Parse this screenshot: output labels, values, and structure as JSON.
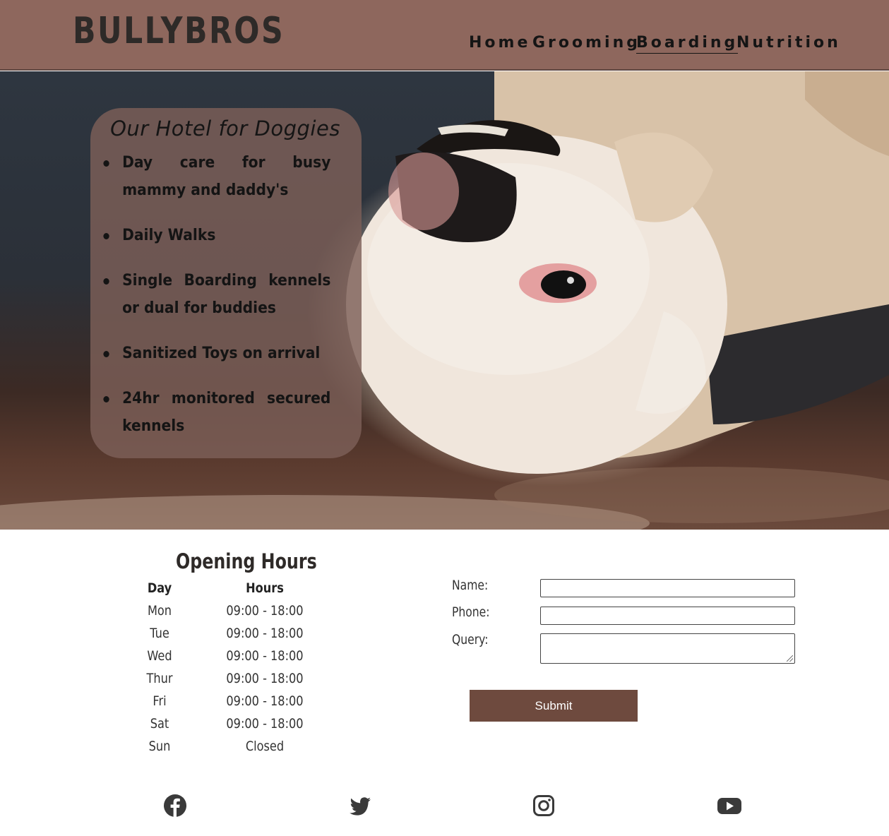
{
  "header": {
    "logo": "BULLYBROS",
    "nav": [
      {
        "label": "Home",
        "active": false
      },
      {
        "label": "Grooming",
        "active": false
      },
      {
        "label": "Boarding",
        "active": true
      },
      {
        "label": "Nutrition",
        "active": false
      }
    ]
  },
  "hero": {
    "title": "Our Hotel for Doggies",
    "features": [
      "Day care for busy mammy and daddy's",
      "Daily Walks",
      "Single Boarding kennels or dual for buddies",
      "Sanitized Toys on arrival",
      "24hr monitored secured kennels"
    ]
  },
  "hours": {
    "title": "Opening Hours",
    "header_day": "Day",
    "header_hours": "Hours",
    "rows": [
      {
        "day": "Mon",
        "hours": "09:00 - 18:00"
      },
      {
        "day": "Tue",
        "hours": "09:00 - 18:00"
      },
      {
        "day": "Wed",
        "hours": "09:00 - 18:00"
      },
      {
        "day": "Thur",
        "hours": "09:00 - 18:00"
      },
      {
        "day": "Fri",
        "hours": "09:00 - 18:00"
      },
      {
        "day": "Sat",
        "hours": "09:00 - 18:00"
      },
      {
        "day": "Sun",
        "hours": "Closed"
      }
    ]
  },
  "form": {
    "name_label": "Name:",
    "name_value": "",
    "phone_label": "Phone:",
    "phone_value": "",
    "query_label": "Query:",
    "query_value": "",
    "submit_label": "Submit"
  },
  "social": [
    "facebook-icon",
    "twitter-icon",
    "instagram-icon",
    "youtube-icon"
  ],
  "colors": {
    "header_bg": "#8e675d",
    "card_bg": "#7d5f58",
    "button_bg": "#6e4a3e",
    "text_dark": "#2e2a28"
  }
}
